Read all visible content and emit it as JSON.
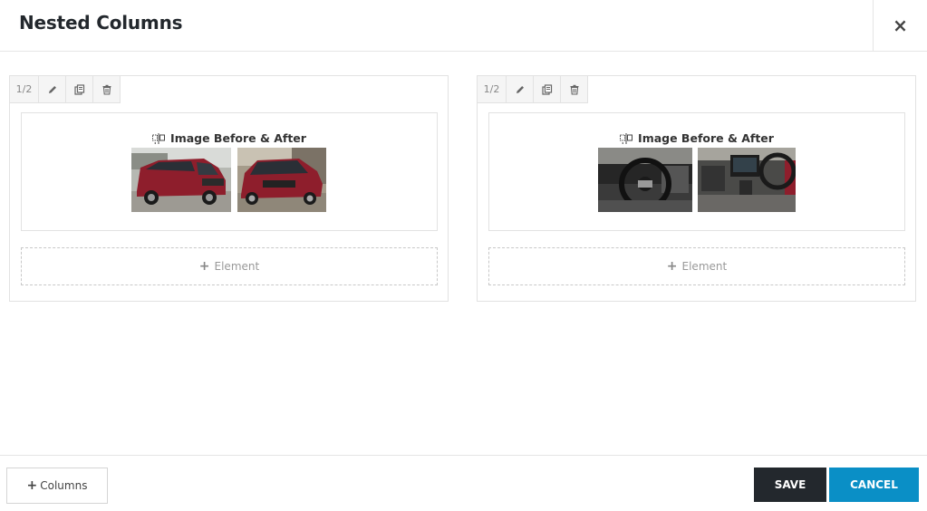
{
  "modal": {
    "title": "Nested Columns",
    "close_label": "×"
  },
  "columns": [
    {
      "size": "1/2",
      "element_title": "Image Before & After",
      "add_element_label": "Element",
      "images": [
        "red-car-front-left",
        "red-car-front-right"
      ]
    },
    {
      "size": "1/2",
      "element_title": "Image Before & After",
      "add_element_label": "Element",
      "images": [
        "car-interior-dashboard",
        "car-interior-console"
      ]
    }
  ],
  "toolbar_icons": [
    "pencil-icon",
    "copy-icon",
    "trash-icon"
  ],
  "footer": {
    "add_columns_label": "Columns",
    "save_label": "SAVE",
    "cancel_label": "CANCEL"
  },
  "colors": {
    "save_bg": "#23282d",
    "cancel_bg": "#0a8fc6",
    "car_red": "#8e1e2c"
  }
}
